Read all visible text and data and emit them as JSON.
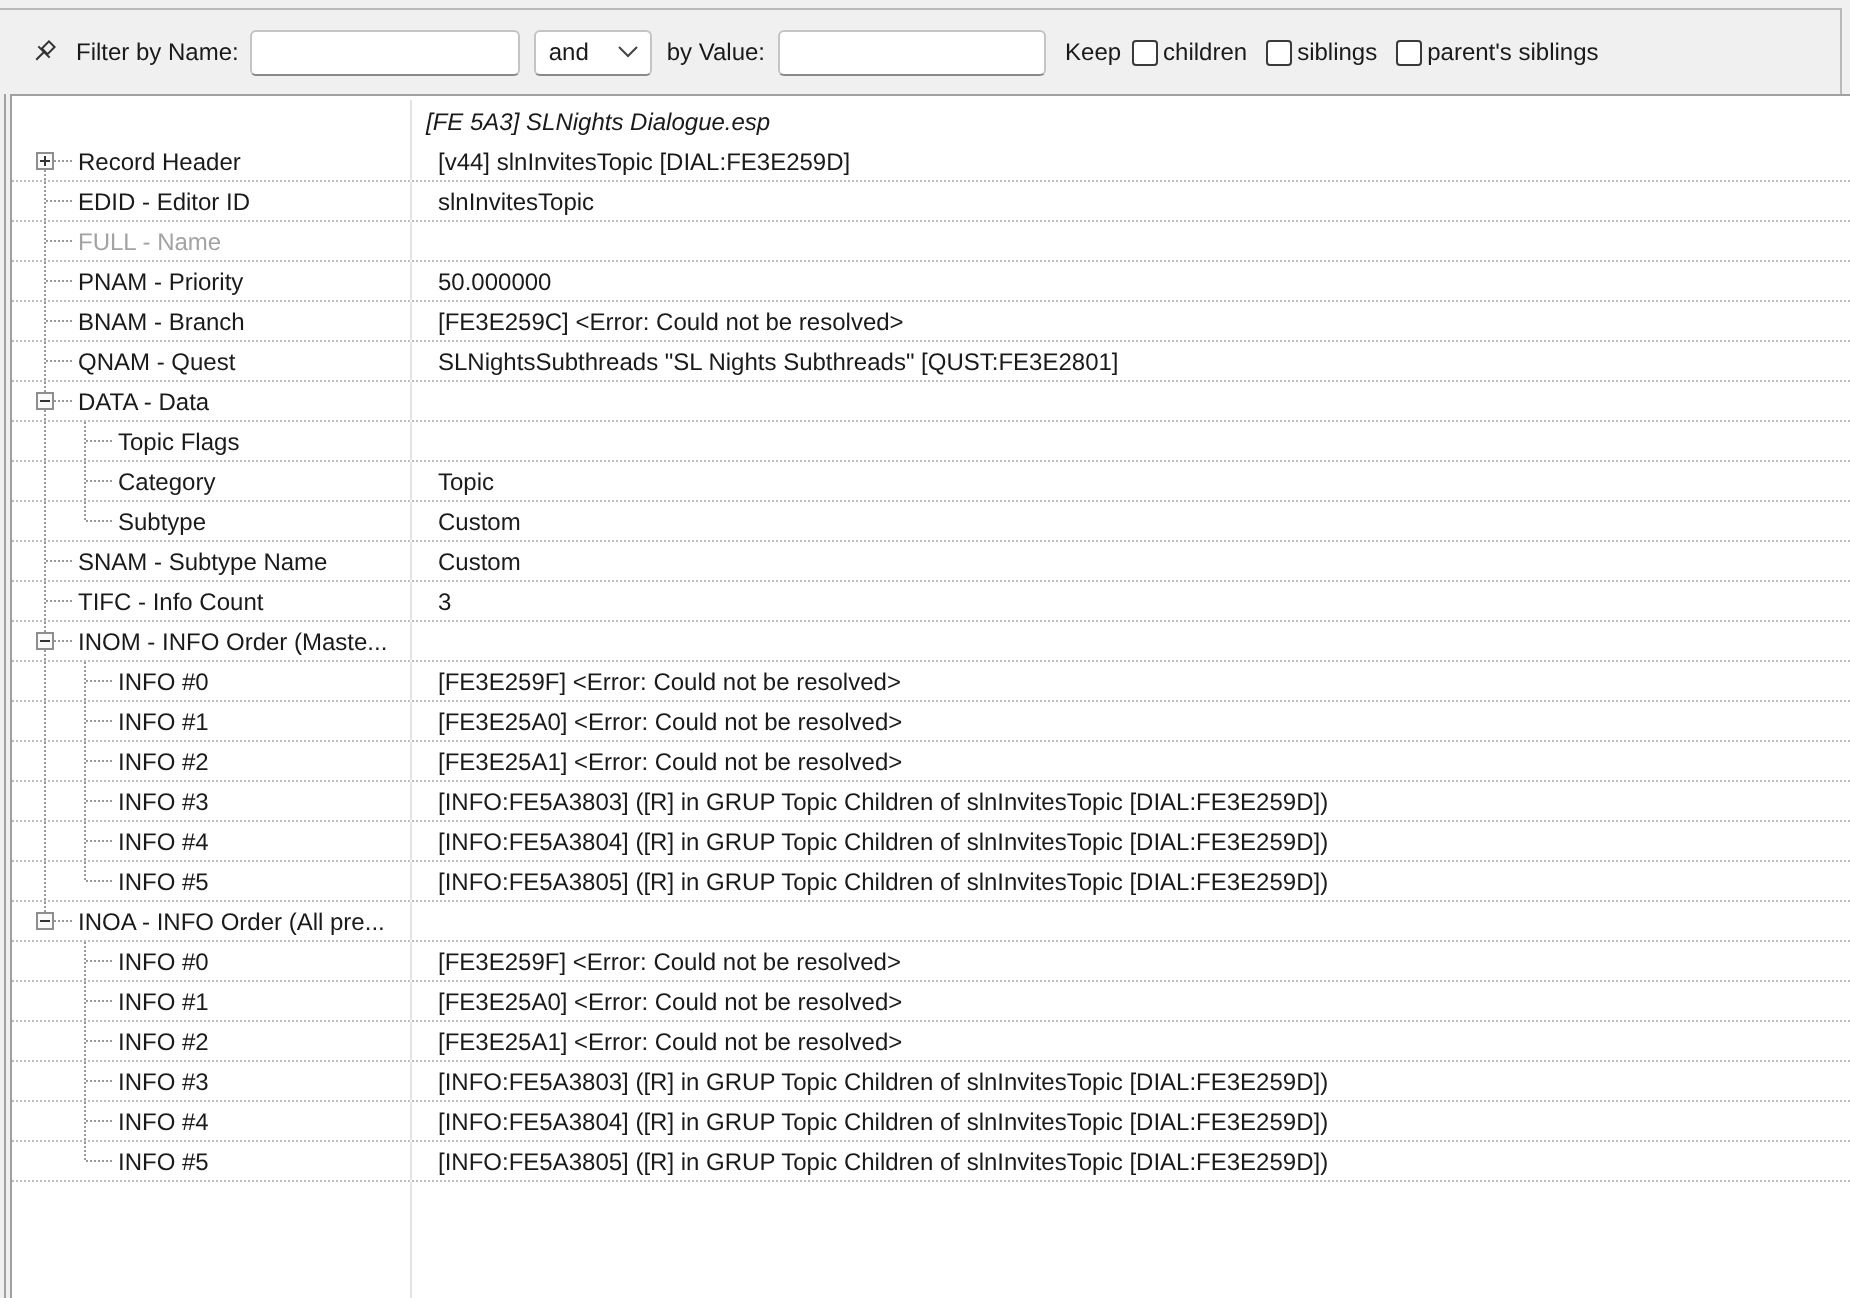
{
  "filter_bar": {
    "name_label": "Filter by Name:",
    "operator": "and",
    "value_label": "by Value:",
    "keep_label": "Keep",
    "keep_options": [
      {
        "label": "children",
        "checked": false
      },
      {
        "label": "siblings",
        "checked": false
      },
      {
        "label": "parent's siblings",
        "checked": false
      }
    ]
  },
  "record": {
    "file": "[FE 5A3] SLNights Dialogue.esp",
    "rows": [
      {
        "kind": "group",
        "label": "Record Header",
        "value": "[v44] slnInvitesTopic [DIAL:FE3E259D]",
        "expanded": false,
        "disabled": false
      },
      {
        "kind": "field",
        "label": "EDID - Editor ID",
        "value": "slnInvitesTopic",
        "disabled": false
      },
      {
        "kind": "field",
        "label": "FULL - Name",
        "disabled": true
      },
      {
        "kind": "field",
        "label": "PNAM - Priority",
        "value": "50.000000",
        "disabled": false
      },
      {
        "kind": "field",
        "label": "BNAM - Branch",
        "value": "[FE3E259C] <Error: Could not be resolved>",
        "disabled": false
      },
      {
        "kind": "field",
        "label": "QNAM - Quest",
        "value": "SLNightsSubthreads \"SL Nights Subthreads\" [QUST:FE3E2801]",
        "disabled": false
      },
      {
        "kind": "group",
        "label": "DATA - Data",
        "expanded": true,
        "disabled": false,
        "children": [
          {
            "kind": "field",
            "label": "Topic Flags",
            "disabled": false
          },
          {
            "kind": "field",
            "label": "Category",
            "value": "Topic",
            "disabled": false
          },
          {
            "kind": "field",
            "label": "Subtype",
            "value": "Custom",
            "disabled": false
          }
        ]
      },
      {
        "kind": "field",
        "label": "SNAM - Subtype Name",
        "value": "Custom",
        "disabled": false
      },
      {
        "kind": "field",
        "label": "TIFC - Info Count",
        "value": "3",
        "disabled": false
      },
      {
        "kind": "group",
        "label": "INOM - INFO Order (Maste...",
        "expanded": true,
        "disabled": false,
        "children": [
          {
            "kind": "field",
            "label": "INFO #0",
            "value": "[FE3E259F] <Error: Could not be resolved>",
            "disabled": false
          },
          {
            "kind": "field",
            "label": "INFO #1",
            "value": "[FE3E25A0] <Error: Could not be resolved>",
            "disabled": false
          },
          {
            "kind": "field",
            "label": "INFO #2",
            "value": "[FE3E25A1] <Error: Could not be resolved>",
            "disabled": false
          },
          {
            "kind": "field",
            "label": "INFO #3",
            "value": "[INFO:FE5A3803] ([R] in GRUP Topic Children of slnInvitesTopic [DIAL:FE3E259D])",
            "disabled": false
          },
          {
            "kind": "field",
            "label": "INFO #4",
            "value": "[INFO:FE5A3804] ([R] in GRUP Topic Children of slnInvitesTopic [DIAL:FE3E259D])",
            "disabled": false
          },
          {
            "kind": "field",
            "label": "INFO #5",
            "value": "[INFO:FE5A3805] ([R] in GRUP Topic Children of slnInvitesTopic [DIAL:FE3E259D])",
            "disabled": false
          }
        ]
      },
      {
        "kind": "group",
        "label": "INOA - INFO Order (All pre...",
        "expanded": true,
        "disabled": false,
        "children": [
          {
            "kind": "field",
            "label": "INFO #0",
            "value": "[FE3E259F] <Error: Could not be resolved>",
            "disabled": false
          },
          {
            "kind": "field",
            "label": "INFO #1",
            "value": "[FE3E25A0] <Error: Could not be resolved>",
            "disabled": false
          },
          {
            "kind": "field",
            "label": "INFO #2",
            "value": "[FE3E25A1] <Error: Could not be resolved>",
            "disabled": false
          },
          {
            "kind": "field",
            "label": "INFO #3",
            "value": "[INFO:FE5A3803] ([R] in GRUP Topic Children of slnInvitesTopic [DIAL:FE3E259D])",
            "disabled": false
          },
          {
            "kind": "field",
            "label": "INFO #4",
            "value": "[INFO:FE5A3804] ([R] in GRUP Topic Children of slnInvitesTopic [DIAL:FE3E259D])",
            "disabled": false
          },
          {
            "kind": "field",
            "label": "INFO #5",
            "value": "[INFO:FE5A3805] ([R] in GRUP Topic Children of slnInvitesTopic [DIAL:FE3E259D])",
            "disabled": false
          }
        ]
      }
    ]
  }
}
